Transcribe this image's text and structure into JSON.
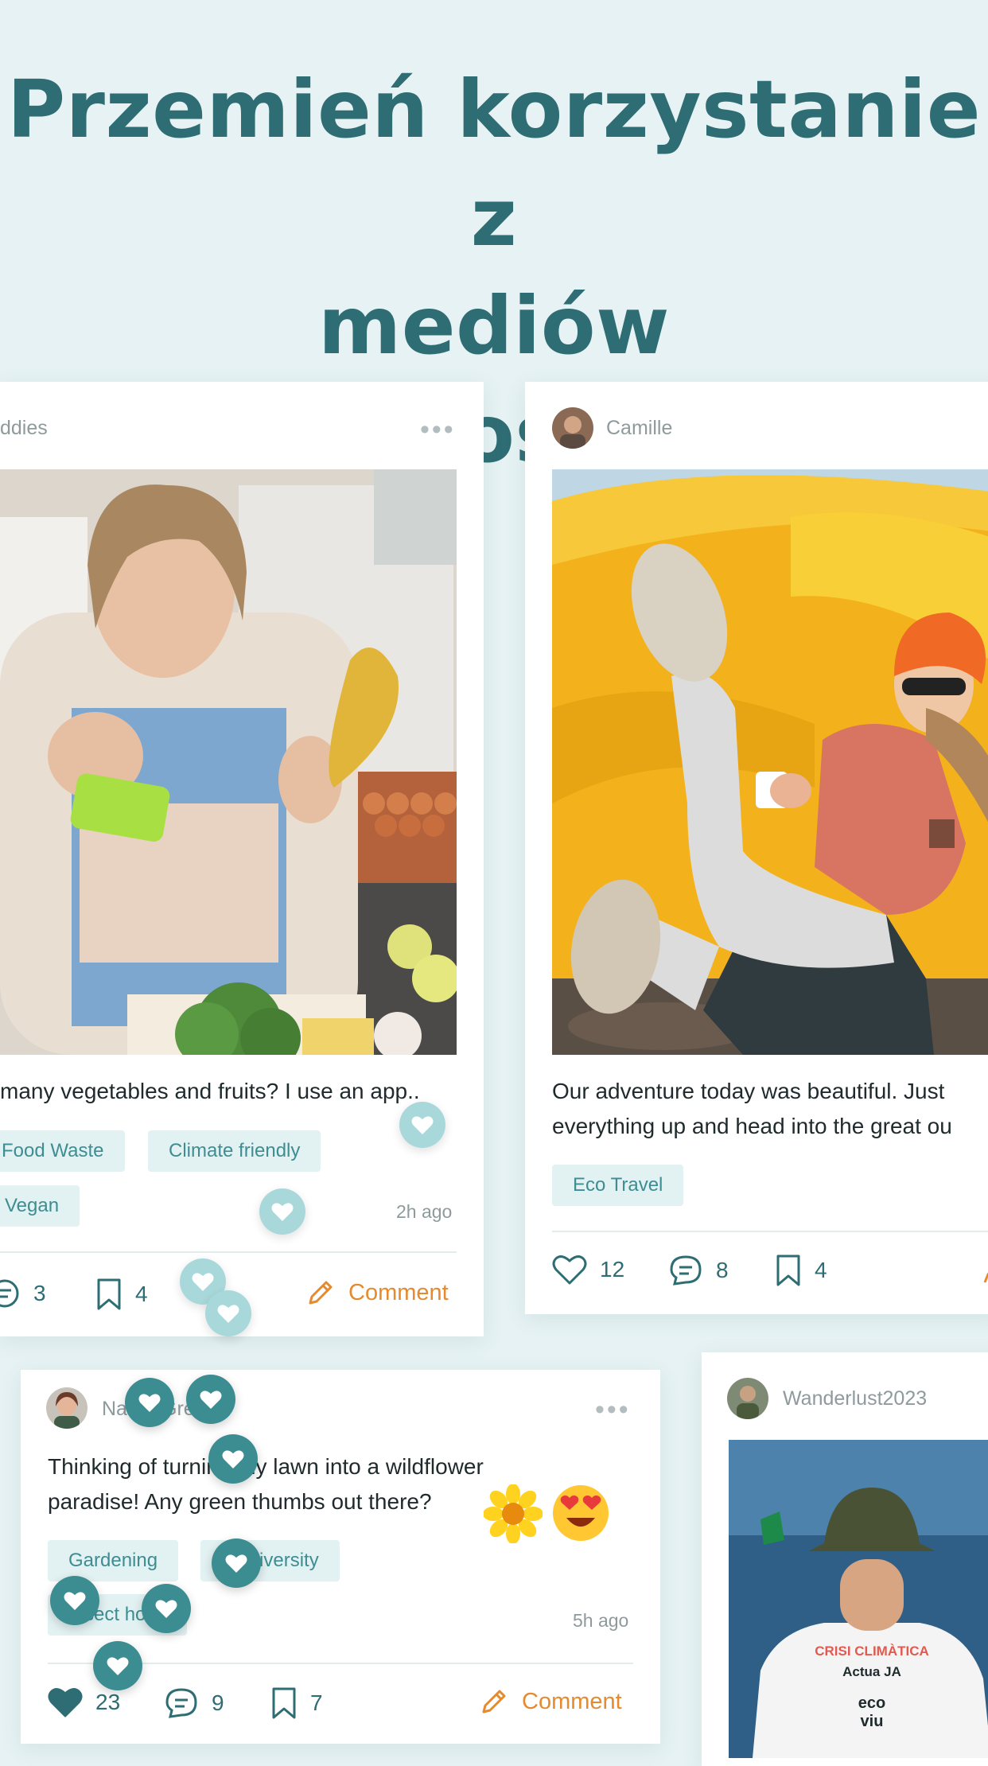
{
  "headline": {
    "line1": "Przemień korzystanie z",
    "line2": "mediów",
    "line3": "społecznościowych"
  },
  "colors": {
    "background": "#e6f2f3",
    "brand_teal": "#2e6d73",
    "accent_orange": "#e58a2e",
    "tag_bg": "#e2f1f2",
    "tag_text": "#3d8d92"
  },
  "posts": [
    {
      "user": "ddies",
      "caption": "many vegetables and fruits? I use an app..",
      "tags": [
        "Food Waste",
        "Climate friendly",
        "Vegan"
      ],
      "time": "2h ago",
      "comments": "3",
      "saves": "4",
      "comment_label": "Comment",
      "menu_icon": "more-dots-icon"
    },
    {
      "user": "Camille",
      "caption_line1": "Our adventure today was beautiful. Just",
      "caption_line2": "everything up and head into the great ou",
      "tags": [
        "Eco Travel"
      ],
      "likes": "12",
      "comments": "8",
      "saves": "4"
    },
    {
      "user": "NatureGreen",
      "caption_line1": "Thinking of turning my lawn into a wildflower",
      "caption_line2": "paradise! Any green thumbs out there?",
      "tags": [
        "Gardening",
        "Biodiversity",
        "Insect hotel"
      ],
      "time": "5h ago",
      "likes": "23",
      "comments": "9",
      "saves": "7",
      "comment_label": "Comment",
      "emojis": [
        "sunflower-emoji",
        "heart-eyes-emoji"
      ]
    },
    {
      "user": "Wanderlust2023",
      "shirt_text": [
        "CRISI CLIMÀTICA",
        "Actua JA",
        "eco",
        "viu"
      ]
    }
  ]
}
